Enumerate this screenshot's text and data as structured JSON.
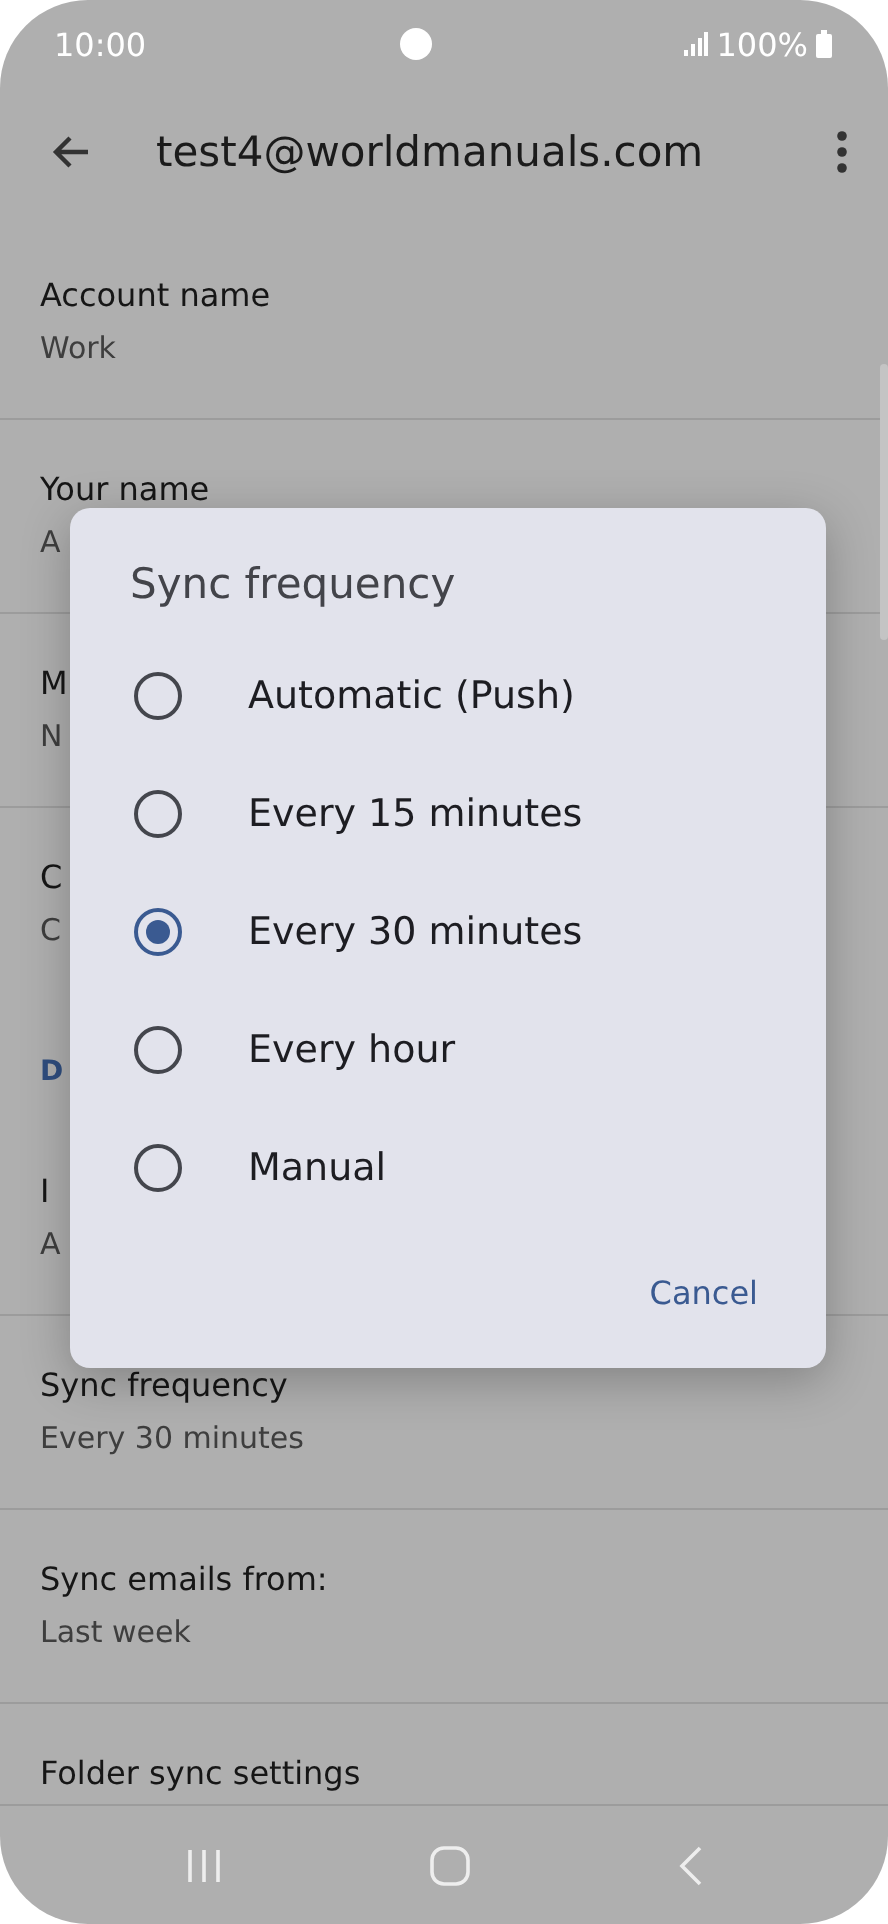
{
  "status_bar": {
    "time": "10:00",
    "battery": "100%"
  },
  "app_bar": {
    "title": "test4@worldmanuals.com"
  },
  "settings": [
    {
      "kind": "item",
      "title": "Account name",
      "subtitle": "Work"
    },
    {
      "kind": "item",
      "title": "Your name",
      "subtitle": "A"
    },
    {
      "kind": "item",
      "title": "M",
      "subtitle": "N"
    },
    {
      "kind": "item",
      "title": "C",
      "subtitle": "C"
    },
    {
      "kind": "header",
      "title": "D"
    },
    {
      "kind": "item",
      "title": "I",
      "subtitle": "A"
    },
    {
      "kind": "item",
      "title": "Sync frequency",
      "subtitle": "Every 30 minutes"
    },
    {
      "kind": "item",
      "title": "Sync emails from:",
      "subtitle": "Last week"
    },
    {
      "kind": "item",
      "title": "Folder sync settings"
    }
  ],
  "dialog": {
    "title": "Sync frequency",
    "options": [
      {
        "label": "Automatic (Push)",
        "selected": false
      },
      {
        "label": "Every 15 minutes",
        "selected": false
      },
      {
        "label": "Every 30 minutes",
        "selected": true
      },
      {
        "label": "Every hour",
        "selected": false
      },
      {
        "label": "Manual",
        "selected": false
      }
    ],
    "buttons": [
      "Cancel"
    ]
  }
}
